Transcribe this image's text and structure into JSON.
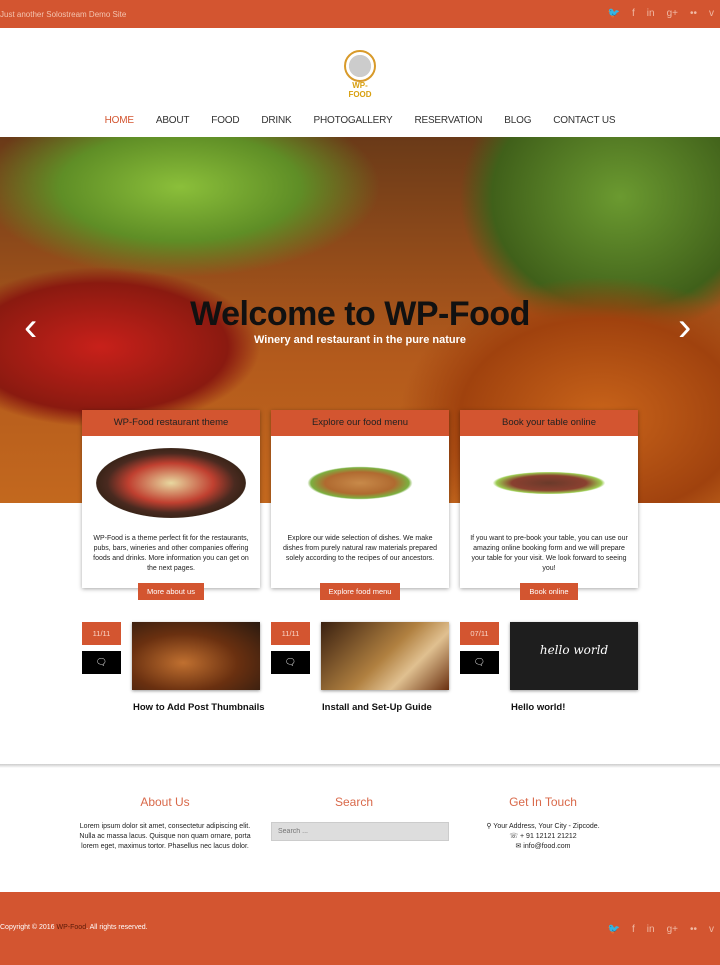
{
  "topbar": {
    "tagline": "Just another Solostream Demo Site"
  },
  "social": [
    "twitter-icon",
    "facebook-icon",
    "linkedin-icon",
    "google-plus-icon",
    "flickr-icon",
    "vimeo-icon"
  ],
  "social_glyphs": [
    "🐦",
    "f",
    "in",
    "g+",
    "••",
    "v"
  ],
  "logo": {
    "text": "WP-FOOD"
  },
  "nav": [
    "HOME",
    "ABOUT",
    "FOOD",
    "DRINK",
    "PHOTOGALLERY",
    "RESERVATION",
    "BLOG",
    "CONTACT US"
  ],
  "hero": {
    "title": "Welcome to WP-Food",
    "subtitle": "Winery and restaurant in the pure nature",
    "prev": "‹",
    "next": "›"
  },
  "cards": [
    {
      "title": "WP-Food restaurant theme",
      "body": "WP-Food is a theme perfect fit for the restaurants, pubs, bars, wineries and other companies offering foods and drinks. More information you can get on the next pages.",
      "button": "More about us"
    },
    {
      "title": "Explore our food menu",
      "body": "Explore our wide selection of dishes. We make dishes from purely natural raw materials prepared solely according to the recipes of our ancestors.",
      "button": "Explore food menu"
    },
    {
      "title": "Book your table online",
      "body": "If you want to pre-book your table, you can use our amazing online booking form and we will prepare your table for your visit. We look forward to seeing you!",
      "button": "Book online"
    }
  ],
  "posts": [
    {
      "date": "11/11",
      "title": "How to Add Post Thumbnails"
    },
    {
      "date": "11/11",
      "title": "Install and Set-Up Guide"
    },
    {
      "date": "07/11",
      "title": "Hello world!",
      "thumb_text": "hello world"
    }
  ],
  "comment_glyph": "🗨",
  "footer_widgets": {
    "about": {
      "title": "About Us",
      "text": "Lorem ipsum dolor sit amet, consectetur adipiscing elit. Nulla ac massa lacus. Quisque non quam ornare, porta lorem eget, maximus tortor. Phasellus nec lacus dolor."
    },
    "search": {
      "title": "Search",
      "placeholder": "Search ..."
    },
    "contact": {
      "title": "Get In Touch",
      "address": "⚲ Your Address, Your City - Zipcode.",
      "phone": "☏ + 91 12121 21212",
      "email": "✉ info@food.com"
    }
  },
  "footer": {
    "copy_prefix": "Copyright © 2016 ",
    "brand": "WP-Food",
    "copy_suffix": ". All rights reserved."
  },
  "colors": {
    "accent": "#d35530"
  }
}
